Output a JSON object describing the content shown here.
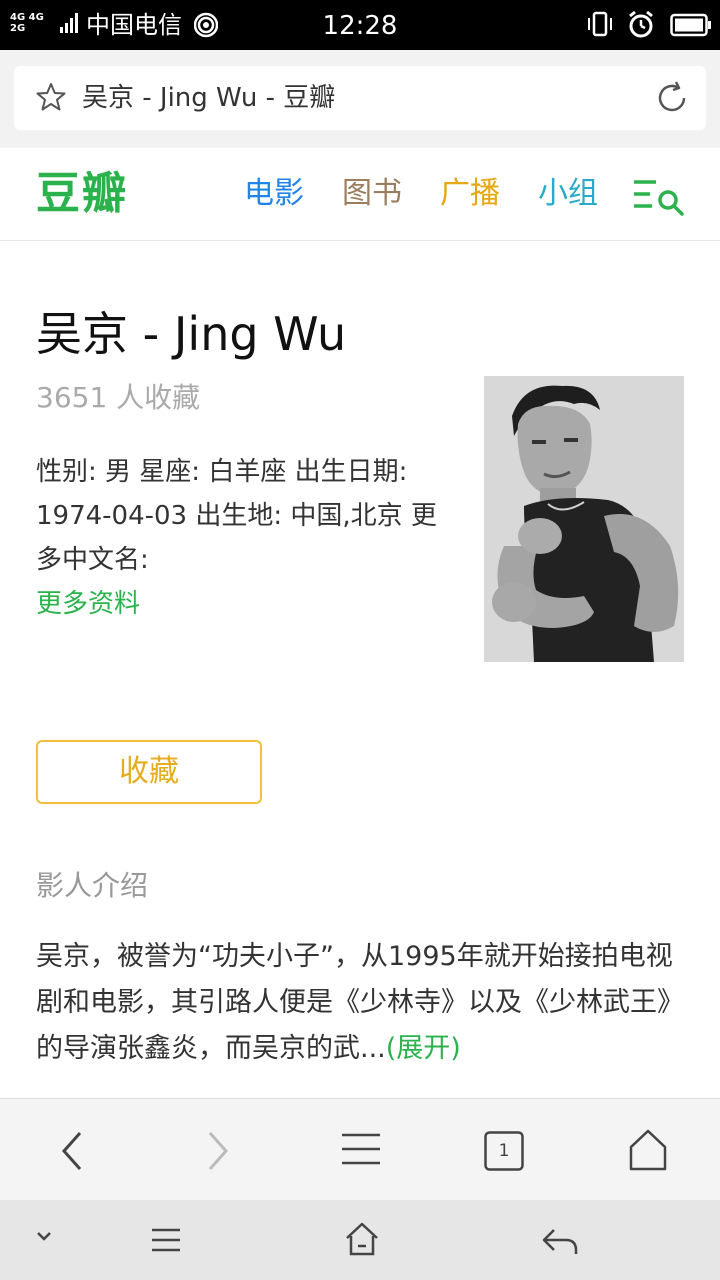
{
  "status_bar": {
    "network_top": "4G 4G",
    "network_bottom": "2G",
    "carrier": "中国电信",
    "time": "12:28"
  },
  "url_bar": {
    "title": "吴京 - Jing Wu - 豆瓣"
  },
  "header": {
    "logo": "豆瓣",
    "nav": {
      "movie": "电影",
      "book": "图书",
      "broadcast": "广播",
      "group": "小组"
    }
  },
  "person": {
    "name": "吴京 - Jing Wu",
    "collect_count": "3651 人收藏",
    "info": "性别: 男 星座: 白羊座 出生日期: 1974-04-03 出生地: 中国,北京 更多中文名:",
    "more_info": "更多资料",
    "collect_button": "收藏"
  },
  "intro": {
    "section_title": "影人介绍",
    "text": "吴京，被誉为“功夫小子”，从1995年就开始接拍电视剧和电影，其引路人便是《少林寺》以及《少林武王》的导演张鑫炎，而吴京的武...",
    "expand": "(展开)"
  },
  "browser_toolbar": {
    "tab_count": "1"
  },
  "colors": {
    "douban_green": "#2bb24c",
    "movie_blue": "#2384e8",
    "book_brown": "#9b7e60",
    "broadcast_yellow": "#e4a813",
    "group_cyan": "#2aa9c9",
    "collect_border": "#f2be3b"
  },
  "icons": {
    "url_left": "star-icon",
    "url_right": "reload-icon",
    "header_right": "menu-search-icon",
    "toolbar": [
      "chevron-left-icon",
      "chevron-right-icon",
      "menu-icon",
      "tabs-icon",
      "home-icon"
    ],
    "system": [
      "chevron-down-icon",
      "menu-icon",
      "home-icon",
      "back-arrow-icon"
    ]
  }
}
